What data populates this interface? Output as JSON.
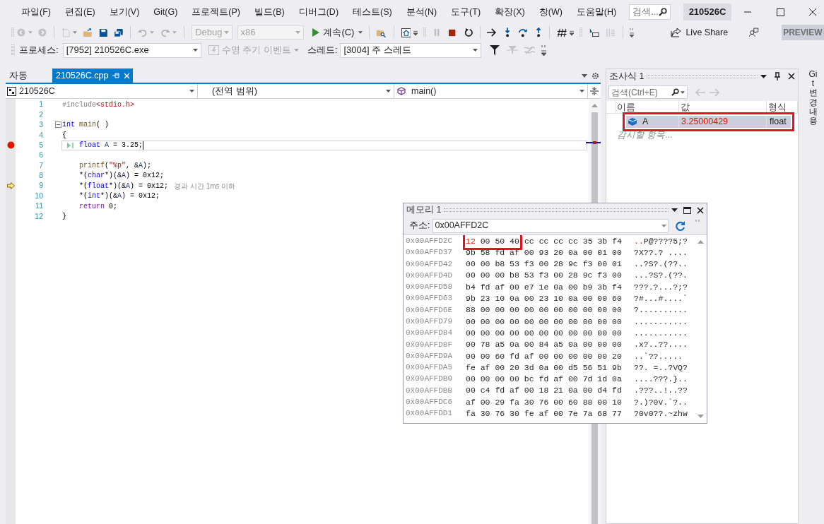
{
  "menu": {
    "items": [
      "파일(F)",
      "편집(E)",
      "보기(V)",
      "Git(G)",
      "프로젝트(P)",
      "빌드(B)",
      "디버그(D)",
      "테스트(S)",
      "분석(N)",
      "도구(T)",
      "확장(X)",
      "창(W)",
      "도움말(H)"
    ],
    "search_placeholder": "검색...",
    "solution": "210526C"
  },
  "toolbar": {
    "configuration": {
      "value": "Debug",
      "disabled": true
    },
    "platform": {
      "value": "x86",
      "disabled": true
    },
    "continue": "계속(C)",
    "live_share": "Live Share",
    "preview": "PREVIEW"
  },
  "debug_location": {
    "process_label": "프로세스:",
    "process": "[7952] 210526C.exe",
    "lifecycle": {
      "label": "수명 주기 이벤트",
      "disabled": true
    },
    "thread_label": "스레드:",
    "thread": "[3004] 주 스레드"
  },
  "doc_tabs": [
    {
      "label": "자동",
      "selected": false
    },
    {
      "label": "210526C.cpp",
      "selected": true
    }
  ],
  "nav_bar": {
    "project": "210526C",
    "scope": "(전역 범위)",
    "member": "main()"
  },
  "code": {
    "lines": [
      {
        "number": "1",
        "highlighted": false,
        "indented": false,
        "breakpoint": false,
        "current": false,
        "tokens": [
          {
            "text": "#include",
            "kind": "preproc"
          },
          {
            "text": "<stdio.h>",
            "kind": "string"
          }
        ]
      },
      {
        "number": "2",
        "highlighted": false,
        "breakpoint": false,
        "current": false
      },
      {
        "number": "3",
        "highlighted": false,
        "indented": false,
        "breakpoint": false,
        "current": false,
        "fold": true,
        "tokens": [
          {
            "text": "int",
            "kind": "keyword"
          },
          {
            "text": " main",
            "kind": "func"
          },
          {
            "text": "( )",
            "kind": "plain"
          }
        ]
      },
      {
        "number": "4",
        "highlighted": false,
        "indented": false,
        "breakpoint": false,
        "current": false,
        "tokens": [
          {
            "text": "{",
            "kind": "plain"
          }
        ]
      },
      {
        "number": "5",
        "highlighted": true,
        "indented": true,
        "breakpoint": true,
        "current": false,
        "run_to_click": true,
        "tokens": [
          {
            "text": "float",
            "kind": "keyword"
          },
          {
            "text": " A",
            "kind": "local"
          },
          {
            "text": " = 3.25;",
            "kind": "plain"
          }
        ]
      },
      {
        "number": "6",
        "highlighted": false,
        "breakpoint": false,
        "current": false
      },
      {
        "number": "7",
        "highlighted": false,
        "indented": true,
        "breakpoint": false,
        "current": false,
        "tokens": [
          {
            "text": "printf",
            "kind": "func"
          },
          {
            "text": "(",
            "kind": "plain"
          },
          {
            "text": "\"%p\"",
            "kind": "string"
          },
          {
            "text": ", &",
            "kind": "plain"
          },
          {
            "text": "A",
            "kind": "local"
          },
          {
            "text": ");",
            "kind": "plain"
          }
        ]
      },
      {
        "number": "8",
        "highlighted": false,
        "indented": true,
        "breakpoint": false,
        "current": false,
        "tokens": [
          {
            "text": "*(",
            "kind": "plain"
          },
          {
            "text": "char",
            "kind": "keyword"
          },
          {
            "text": "*)(&",
            "kind": "plain"
          },
          {
            "text": "A",
            "kind": "local"
          },
          {
            "text": ") = 0x12;",
            "kind": "plain"
          }
        ]
      },
      {
        "number": "9",
        "highlighted": false,
        "indented": true,
        "breakpoint": false,
        "current": true,
        "hint": "경과 시간 1ms 이하",
        "tokens": [
          {
            "text": "*(",
            "kind": "plain"
          },
          {
            "text": "float",
            "kind": "keyword"
          },
          {
            "text": "*)(&",
            "kind": "plain"
          },
          {
            "text": "A",
            "kind": "local"
          },
          {
            "text": ") = 0x12;",
            "kind": "plain"
          }
        ]
      },
      {
        "number": "10",
        "highlighted": false,
        "indented": true,
        "breakpoint": false,
        "current": false,
        "tokens": [
          {
            "text": "*(",
            "kind": "plain"
          },
          {
            "text": "int",
            "kind": "keyword"
          },
          {
            "text": "*)(&",
            "kind": "plain"
          },
          {
            "text": "A",
            "kind": "local"
          },
          {
            "text": ") = 0x12;",
            "kind": "plain"
          }
        ]
      },
      {
        "number": "11",
        "highlighted": false,
        "indented": true,
        "breakpoint": false,
        "current": false,
        "tokens": [
          {
            "text": "return",
            "kind": "control"
          },
          {
            "text": " 0;",
            "kind": "plain"
          }
        ]
      },
      {
        "number": "12",
        "highlighted": false,
        "indented": false,
        "breakpoint": false,
        "current": false,
        "tokens": [
          {
            "text": "}",
            "kind": "plain"
          }
        ]
      }
    ]
  },
  "watch": {
    "title": "조사식 1",
    "search_placeholder": "검색(Ctrl+E)",
    "columns": [
      "이름",
      "값",
      "형식"
    ],
    "rows": [
      {
        "name": "A",
        "value": "3.25000429",
        "type": "float",
        "changed": true,
        "boxed": true
      }
    ],
    "add_placeholder": "감시할 항목..."
  },
  "memory": {
    "title": "메모리 1",
    "address_label": "주소:",
    "address": "0x00AFFD2C",
    "rows": [
      {
        "address": "0x00AFFD2C",
        "boxed_changed": "12",
        "boxed": "00 50 40",
        "bytes": "cc cc cc cc 35 3b f4",
        "ascii_changed": "..",
        "ascii": "P@????5;?"
      },
      {
        "address": "0x00AFFD37",
        "bytes": "9b 58 fd af 00 93 20 0a 00 01 00",
        "ascii": "?X??.? ...."
      },
      {
        "address": "0x00AFFD42",
        "bytes": "00 00 b8 53 f3 00 28 9c f3 00 01",
        "ascii": "..?S?.(??.."
      },
      {
        "address": "0x00AFFD4D",
        "bytes": "00 00 00 b8 53 f3 00 28 9c f3 00",
        "ascii": "...?S?.(??."
      },
      {
        "address": "0x00AFFD58",
        "bytes": "b4 fd af 00 e7 1e 0a 00 b9 3b f4",
        "ascii": "???.?...?;?"
      },
      {
        "address": "0x00AFFD63",
        "bytes": "9b 23 10 0a 00 23 10 0a 00 00 60",
        "ascii": "?#...#....`"
      },
      {
        "address": "0x00AFFD6E",
        "bytes": "88 00 00 00 00 00 00 00 00 00 00",
        "ascii": "?.........."
      },
      {
        "address": "0x00AFFD79",
        "bytes": "00 00 00 00 00 00 00 00 00 00 00",
        "ascii": "..........."
      },
      {
        "address": "0x00AFFD84",
        "bytes": "00 00 00 00 00 00 00 00 00 00 00",
        "ascii": "..........."
      },
      {
        "address": "0x00AFFD8F",
        "bytes": "00 78 a5 0a 00 84 a5 0a 00 00 00",
        "ascii": ".x?..??...."
      },
      {
        "address": "0x00AFFD9A",
        "bytes": "00 00 60 fd af 00 00 00 00 00 20",
        "ascii": "..`??....."
      },
      {
        "address": "0x00AFFDA5",
        "bytes": "fe af 00 20 3d 0a 00 d5 56 51 9b",
        "ascii": "??. =..?VQ?"
      },
      {
        "address": "0x00AFFDB0",
        "bytes": "00 00 00 00 bc fd af 00 7d 1d 0a",
        "ascii": "....???.}.."
      },
      {
        "address": "0x00AFFDBB",
        "bytes": "00 c4 fd af 00 18 21 0a 00 d4 fd",
        "ascii": ".???..!..??"
      },
      {
        "address": "0x00AFFDC6",
        "bytes": "af 00 29 fa 30 76 00 60 88 00 10",
        "ascii": "?.)?0v.`?.."
      },
      {
        "address": "0x00AFFDD1",
        "bytes": "fa 30 76 30 fe af 00 7e 7a 68 77",
        "ascii": "?0v0??.~zhw"
      }
    ]
  },
  "side_tab": "Git 변경 내용"
}
